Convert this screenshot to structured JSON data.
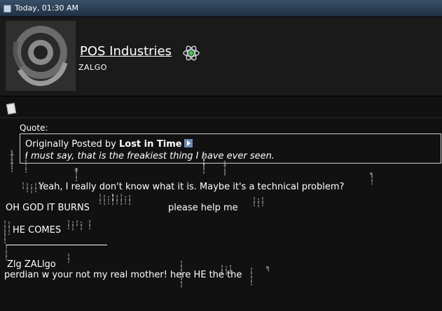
{
  "header": {
    "date": "Today, 01:30 AM"
  },
  "user": {
    "name": "POS Industries",
    "title": "ZALGO"
  },
  "quote": {
    "label": "Quote:",
    "prefix": "Originally Posted by",
    "author": "Lost in Time",
    "text": "I must say, that is the freakiest thing I have ever seen."
  },
  "post": {
    "line1": "Yeah, I really don't know what it is.      Maybe it's a technical problem?",
    "line2a": "OH GOD IT BURNS",
    "line2b": "please  help  me",
    "line3": "HE COMES",
    "line4": "Zlg  ZALlgo",
    "line5": "perdian  w your not my real mother!  here  HE  the  the"
  },
  "colors": {
    "header_bg": "#2b4058",
    "body_bg": "#111111",
    "text": "#ffffff"
  }
}
